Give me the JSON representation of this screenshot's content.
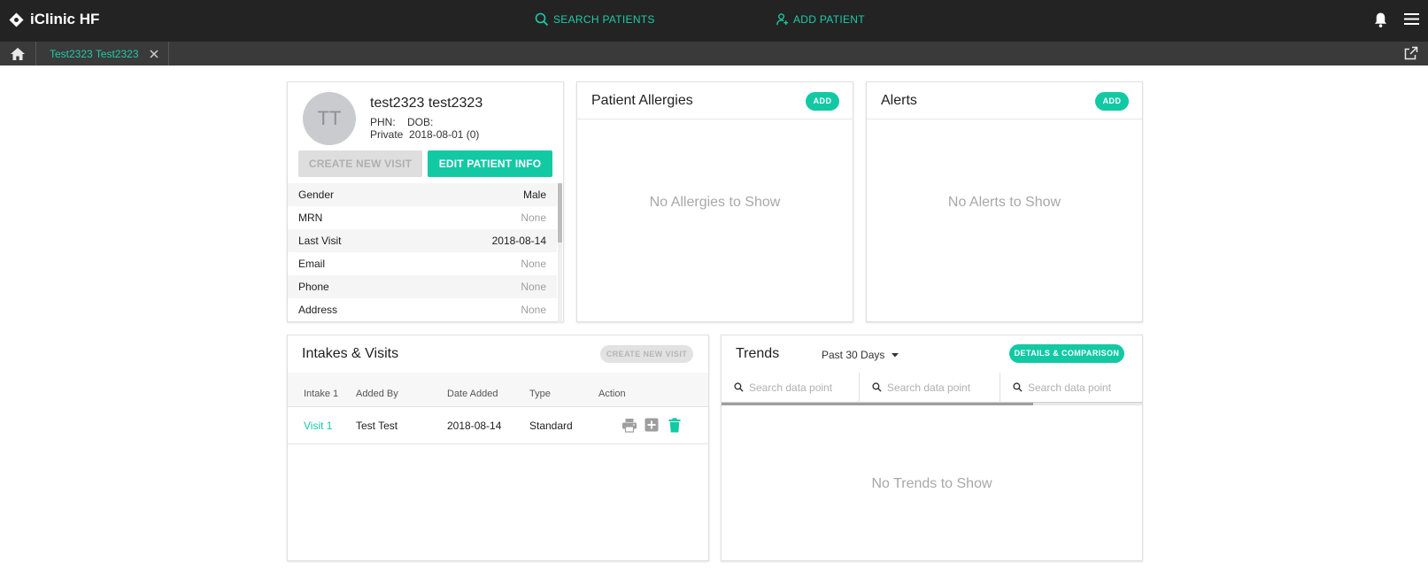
{
  "app": {
    "title": "iClinic HF"
  },
  "nav": {
    "search_patients": "SEARCH PATIENTS",
    "add_patient": "ADD PATIENT"
  },
  "tabs": {
    "patient_tab_label": "Test2323 Test2323"
  },
  "patient": {
    "initials": "TT",
    "name": "test2323 test2323",
    "phn_label": "PHN:",
    "dob_label": "DOB:",
    "coverage": "Private",
    "dob_value": "2018-08-01 (0)",
    "create_visit_label": "CREATE NEW VISIT",
    "edit_info_label": "EDIT PATIENT INFO",
    "details": [
      {
        "key": "Gender",
        "value": "Male"
      },
      {
        "key": "MRN",
        "value": "None"
      },
      {
        "key": "Last Visit",
        "value": "2018-08-14"
      },
      {
        "key": "Email",
        "value": "None"
      },
      {
        "key": "Phone",
        "value": "None"
      },
      {
        "key": "Address",
        "value": "None"
      }
    ]
  },
  "allergies": {
    "title": "Patient Allergies",
    "add_label": "ADD",
    "empty_text": "No Allergies to Show"
  },
  "alerts": {
    "title": "Alerts",
    "add_label": "ADD",
    "empty_text": "No Alerts to Show"
  },
  "visits": {
    "title": "Intakes & Visits",
    "create_label": "CREATE NEW VISIT",
    "columns": [
      "Intake 1",
      "Added By",
      "Date Added",
      "Type",
      "Action"
    ],
    "rows": [
      {
        "name": "Visit 1",
        "added_by": "Test Test",
        "date_added": "2018-08-14",
        "type": "Standard"
      }
    ]
  },
  "trends": {
    "title": "Trends",
    "range_label": "Past 30 Days",
    "details_label": "DETAILS & COMPARISON",
    "search_placeholders": [
      "Search data point",
      "Search data point",
      "Search data point"
    ],
    "empty_text": "No Trends to Show",
    "progress_fraction": 0.74
  },
  "colors": {
    "accent": "#12c9a4",
    "topbar": "#232323",
    "tabbar": "#3a3a3a"
  },
  "icons": [
    "logo-icon",
    "search-icon",
    "add-person-icon",
    "bell-icon",
    "menu-icon",
    "home-icon",
    "close-icon",
    "popout-icon",
    "chevron-down-icon",
    "print-icon",
    "add-box-icon",
    "trash-icon"
  ]
}
